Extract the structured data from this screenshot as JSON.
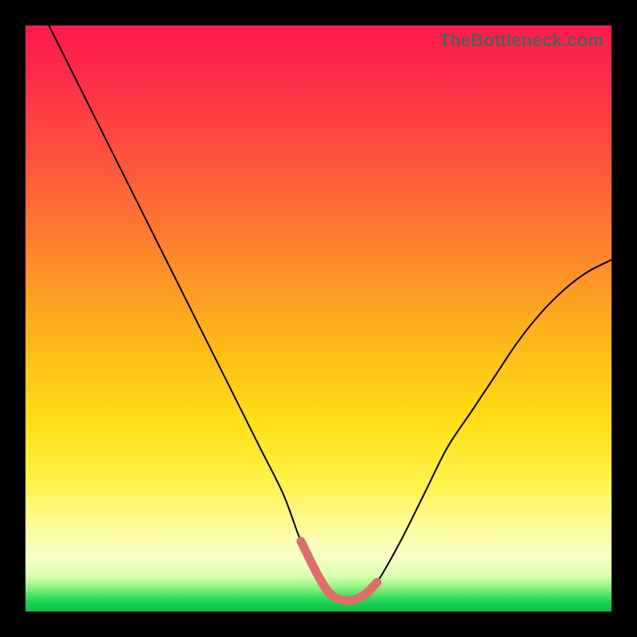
{
  "watermark": "TheBottleneck.com",
  "chart_data": {
    "type": "line",
    "title": "",
    "xlabel": "",
    "ylabel": "",
    "xlim": [
      0,
      100
    ],
    "ylim": [
      0,
      100
    ],
    "grid": false,
    "legend": false,
    "background": {
      "kind": "vertical-gradient",
      "meaning": "bottleneck severity (red high → green low)",
      "stops": [
        {
          "pos": 0.0,
          "color": "#ff1a4d"
        },
        {
          "pos": 0.4,
          "color": "#ff8a2a"
        },
        {
          "pos": 0.68,
          "color": "#ffe016"
        },
        {
          "pos": 0.91,
          "color": "#f7ffc8"
        },
        {
          "pos": 1.0,
          "color": "#0cbf4a"
        }
      ]
    },
    "series": [
      {
        "name": "bottleneck-curve",
        "color": "#000000",
        "x": [
          4,
          8,
          12,
          16,
          20,
          24,
          28,
          32,
          36,
          40,
          44,
          47,
          50,
          52,
          54,
          56,
          58,
          60,
          64,
          68,
          72,
          76,
          80,
          84,
          88,
          92,
          96,
          100
        ],
        "y": [
          100,
          92,
          84,
          76,
          68,
          60,
          52,
          44,
          36,
          28,
          20,
          12,
          6,
          3,
          2,
          2,
          3,
          5,
          12,
          20,
          28,
          34,
          40,
          46,
          51,
          55,
          58,
          60
        ]
      }
    ],
    "highlight": {
      "name": "optimal-zone-marker",
      "color": "#dd6e6b",
      "x": [
        47,
        50,
        52,
        54,
        56,
        58,
        60
      ],
      "y": [
        12,
        6,
        3,
        2,
        2,
        3,
        5
      ]
    }
  }
}
